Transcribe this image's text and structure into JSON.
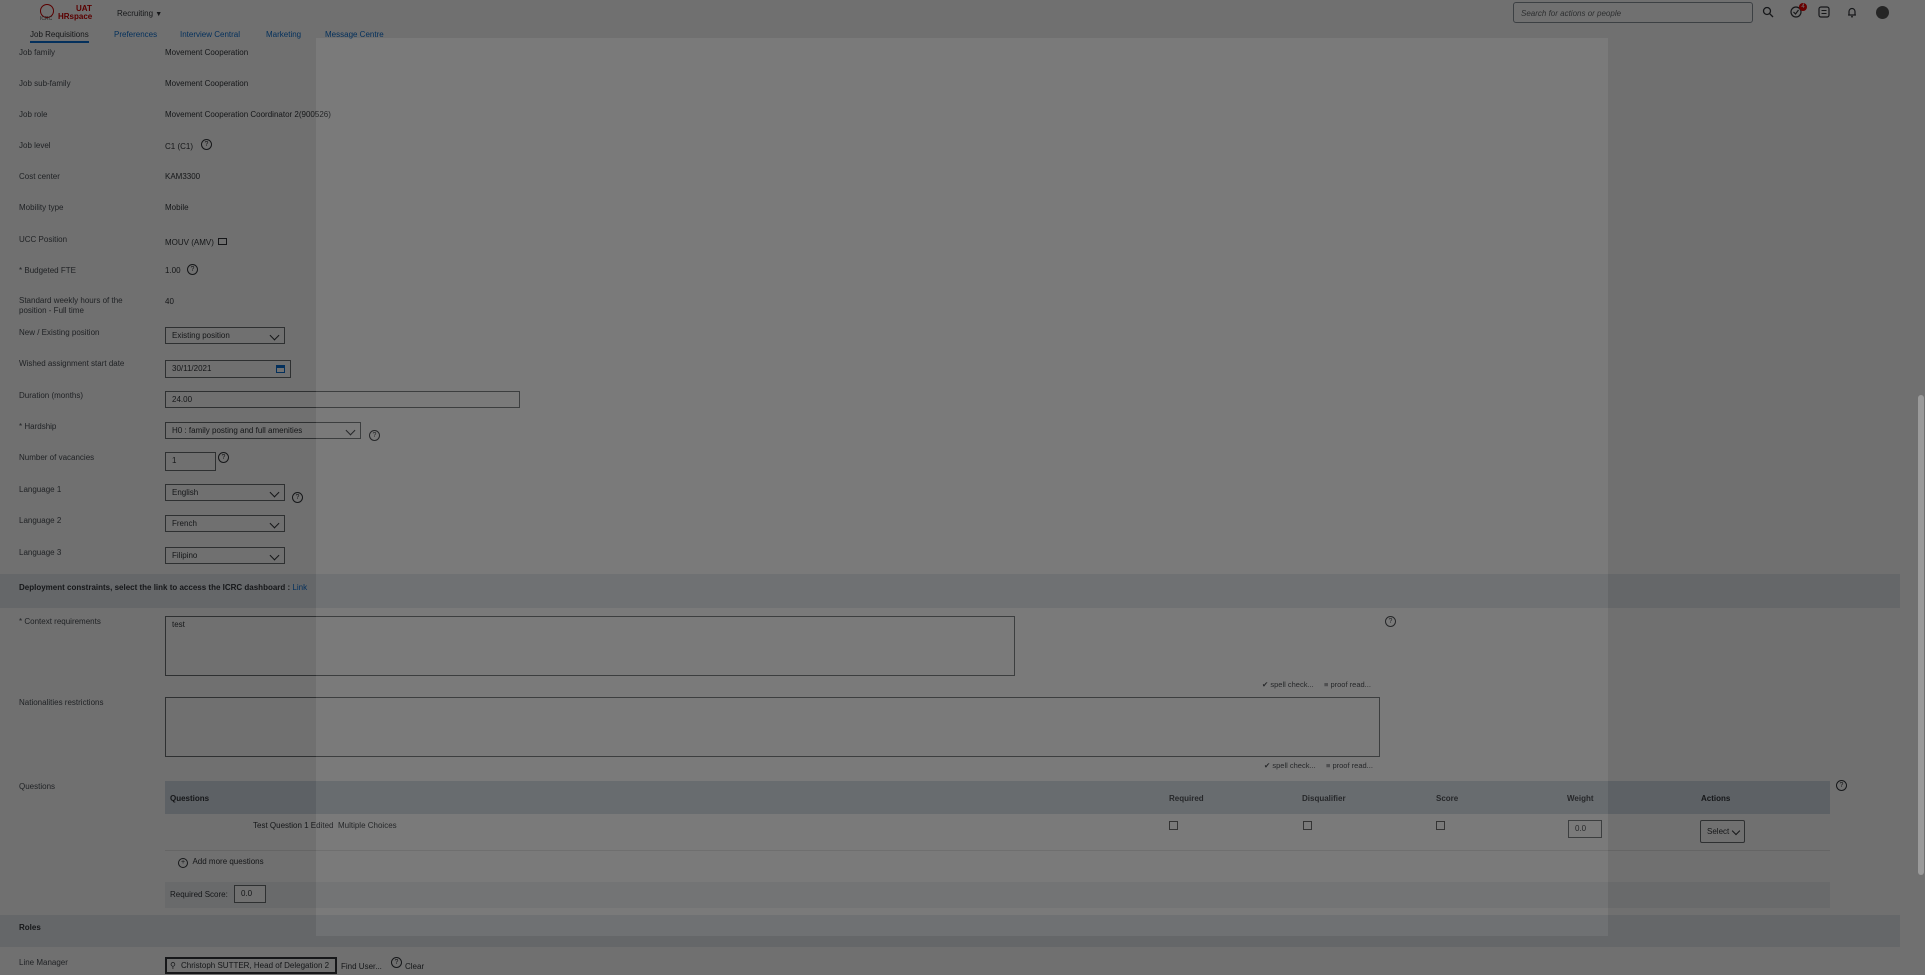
{
  "header": {
    "logo_org": "ICRC",
    "logo_env": "UAT",
    "logo_name": "HRspace",
    "module": "Recruiting",
    "search_placeholder": "Search for actions or people",
    "notification_count": "4"
  },
  "tabs": [
    {
      "label": "Job Requisitions"
    },
    {
      "label": "Preferences"
    },
    {
      "label": "Interview Central"
    },
    {
      "label": "Marketing"
    },
    {
      "label": "Message Centre"
    }
  ],
  "fields": {
    "job_family": {
      "label": "Job family",
      "value": "Movement Cooperation"
    },
    "job_sub_family": {
      "label": "Job sub-family",
      "value": "Movement Cooperation"
    },
    "job_role": {
      "label": "Job role",
      "value": "Movement Cooperation Coordinator 2(900526)"
    },
    "job_level": {
      "label": "Job level",
      "value": "C1 (C1)"
    },
    "cost_center": {
      "label": "Cost center",
      "value": "KAM3300"
    },
    "mobility_type": {
      "label": "Mobility type",
      "value": "Mobile"
    },
    "ucc_position": {
      "label": "UCC Position",
      "value": "MOUV (AMV)"
    },
    "budgeted_fte": {
      "label": "Budgeted FTE",
      "value": "1.00"
    },
    "weekly_hours": {
      "label": "Standard weekly hours of the position - Full time",
      "value": "40"
    },
    "new_existing": {
      "label": "New / Existing position",
      "value": "Existing position"
    },
    "start_date": {
      "label": "Wished assignment start date",
      "value": "30/11/2021"
    },
    "duration": {
      "label": "Duration (months)",
      "value": "24.00"
    },
    "hardship": {
      "label": "Hardship",
      "value": "H0 : family posting and full amenities"
    },
    "vacancies": {
      "label": "Number of vacancies",
      "value": "1"
    },
    "language1": {
      "label": "Language 1",
      "value": "English"
    },
    "language2": {
      "label": "Language 2",
      "value": "French"
    },
    "language3": {
      "label": "Language 3",
      "value": "Filipino"
    }
  },
  "required_mark": "*",
  "deployment": {
    "heading": "Deployment constraints, select the link to access the ICRC dashboard :",
    "link": "Link"
  },
  "context_requirements": {
    "label": "Context requirements",
    "value": "test"
  },
  "nationalities": {
    "label": "Nationalities restrictions",
    "value": ""
  },
  "spell_check": "spell check...",
  "proof_read": "proof read...",
  "questions": {
    "label": "Questions",
    "headers": [
      "Questions",
      "Required",
      "Disqualifier",
      "Score",
      "Weight",
      "Actions"
    ],
    "rows": [
      {
        "question": "Test Question 1 Edited",
        "type": "Multiple Choices",
        "weight": "0.0",
        "action": "Select"
      }
    ],
    "add_more": "Add more questions",
    "required_score_label": "Required Score:",
    "required_score_value": "0.0"
  },
  "roles": {
    "heading": "Roles",
    "line_manager_label": "Line Manager",
    "line_manager_value": "Christoph SUTTER, Head of Delegation 2",
    "find_user": "Find User...",
    "clear": "Clear"
  }
}
